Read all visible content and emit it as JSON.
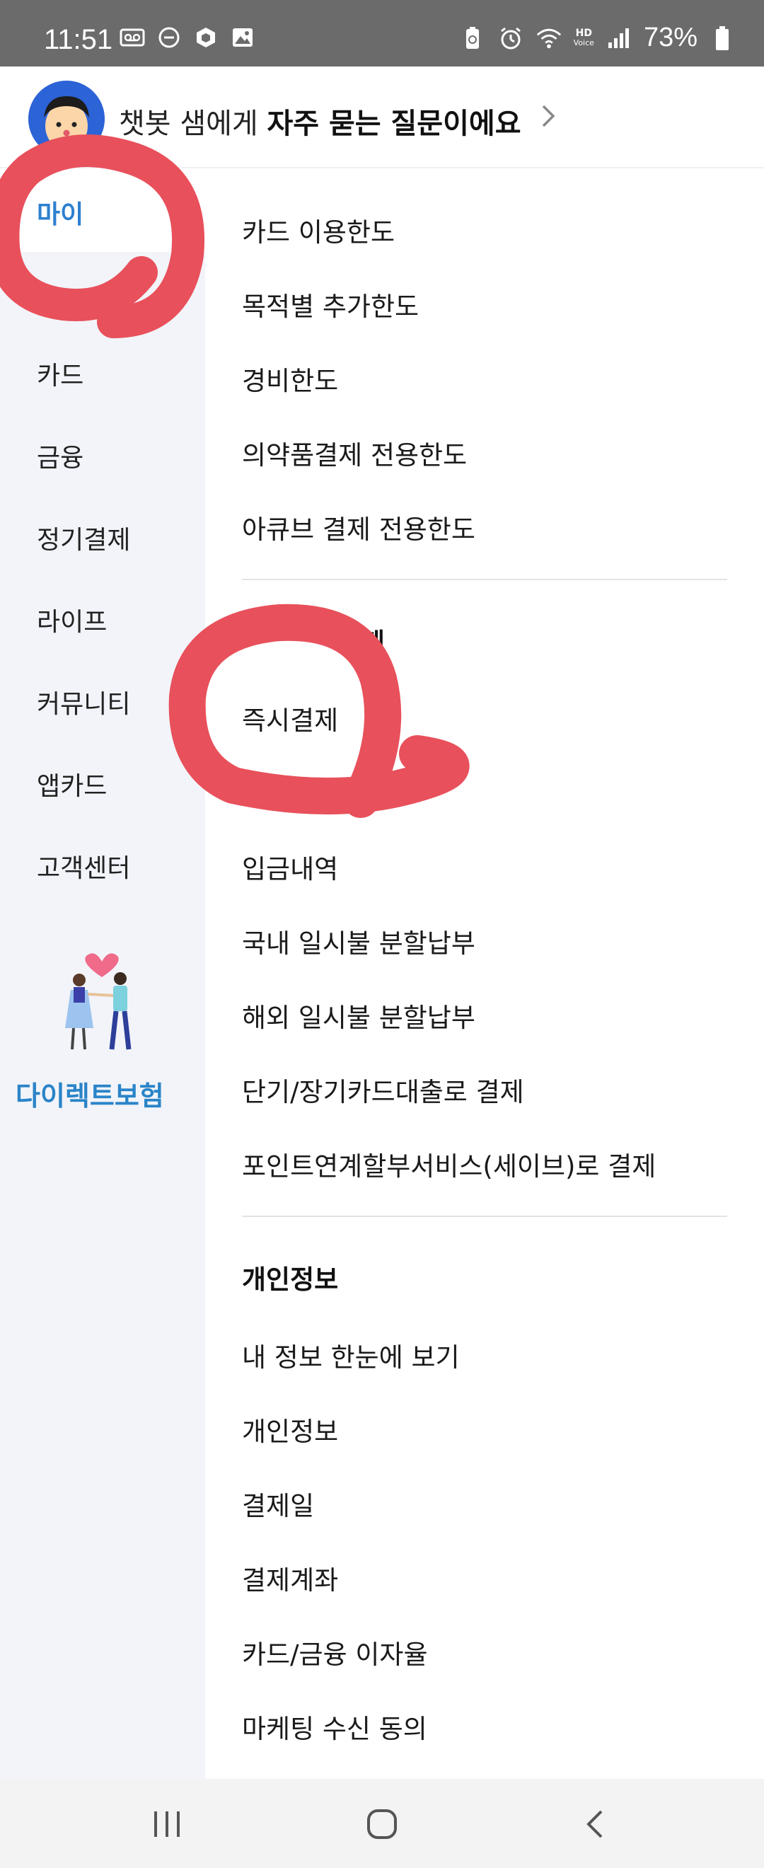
{
  "status_bar": {
    "time": "11:51",
    "battery": "73%",
    "hd_label": "HD",
    "voice_label": "Voice",
    "icons_left": [
      "voicemail-icon",
      "minus-circle-icon",
      "cube-icon",
      "image-icon"
    ],
    "icons_right": [
      "battery-saver-icon",
      "alarm-icon",
      "wifi-icon",
      "signal-icon",
      "battery-icon"
    ]
  },
  "header": {
    "text_plain": "챗봇 샘에게 ",
    "text_bold": "자주 묻는 질문이에요",
    "avatar_icon": "chatbot-avatar-icon"
  },
  "sidebar": {
    "items": [
      {
        "label": "마이",
        "active": true
      },
      {
        "label": "카드"
      },
      {
        "label": "금융"
      },
      {
        "label": "정기결제"
      },
      {
        "label": "라이프"
      },
      {
        "label": "커뮤니티"
      },
      {
        "label": "앱카드"
      },
      {
        "label": "고객센터"
      }
    ],
    "promo_label": "다이렉트보험"
  },
  "content": {
    "section1": [
      "카드 이용한도",
      "목적별 추가한도",
      "경비한도",
      "의약품결제 전용한도",
      "아큐브 결제 전용한도"
    ],
    "section2_head": "결제",
    "section2": [
      "즉시결제",
      "입금내역",
      "국내 일시불 분할납부",
      "해외 일시불 분할납부",
      "단기/장기카드대출로 결제",
      "포인트연계할부서비스(세이브)로 결제"
    ],
    "section3_head": "개인정보",
    "section3": [
      "내 정보 한눈에 보기",
      "개인정보",
      "결제일",
      "결제계좌",
      "카드/금융 이자율",
      "마케팅 수신 동의"
    ]
  },
  "colors": {
    "accent": "#2d7fd0",
    "sidebar_bg": "#f2f4f9",
    "annotation_red": "#e8505b",
    "statusbar_bg": "#6b6b6b"
  },
  "navbar": {
    "icons": [
      "recent-apps-icon",
      "home-icon",
      "back-icon"
    ]
  }
}
